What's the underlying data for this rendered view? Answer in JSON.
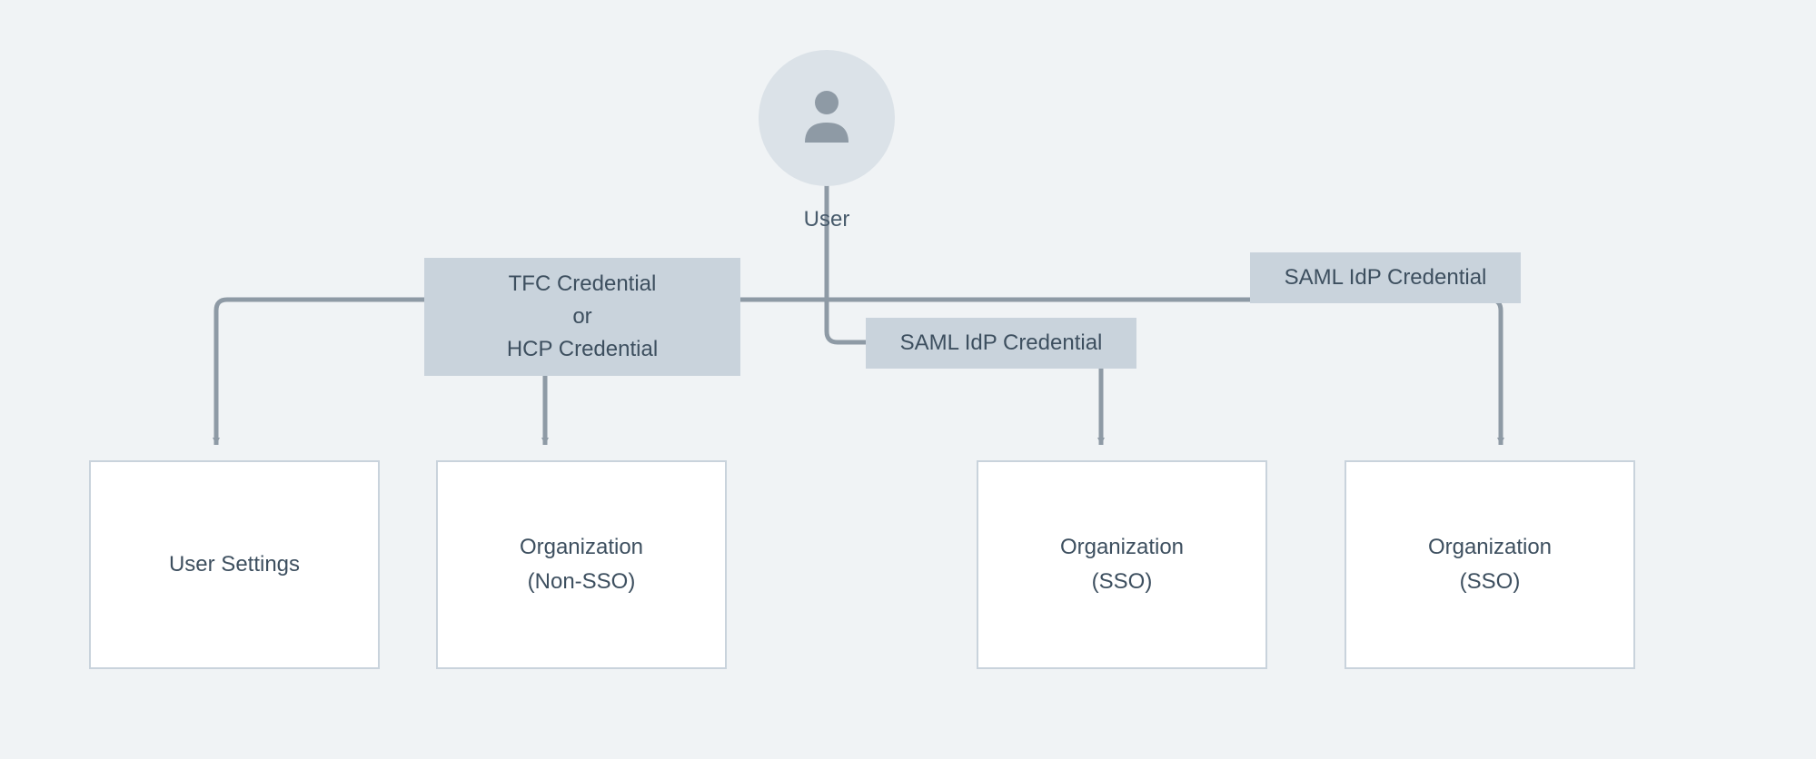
{
  "nodes": {
    "user_label": "User",
    "cred_tfc_hcp": "TFC Credential\nor\nHCP Credential",
    "cred_saml_1": "SAML IdP Credential",
    "cred_saml_2": "SAML IdP Credential",
    "box_user_settings": "User Settings",
    "box_org_nonsso": "Organization\n(Non-SSO)",
    "box_org_sso_1": "Organization\n(SSO)",
    "box_org_sso_2": "Organization\n(SSO)"
  },
  "colors": {
    "bg": "#f0f3f5",
    "avatar_bg": "#dbe2e8",
    "pill_bg": "#c9d3dc",
    "box_bg": "#ffffff",
    "box_border": "#c9d3dc",
    "text": "#3d4f5f",
    "connector": "#8e9aa5"
  }
}
